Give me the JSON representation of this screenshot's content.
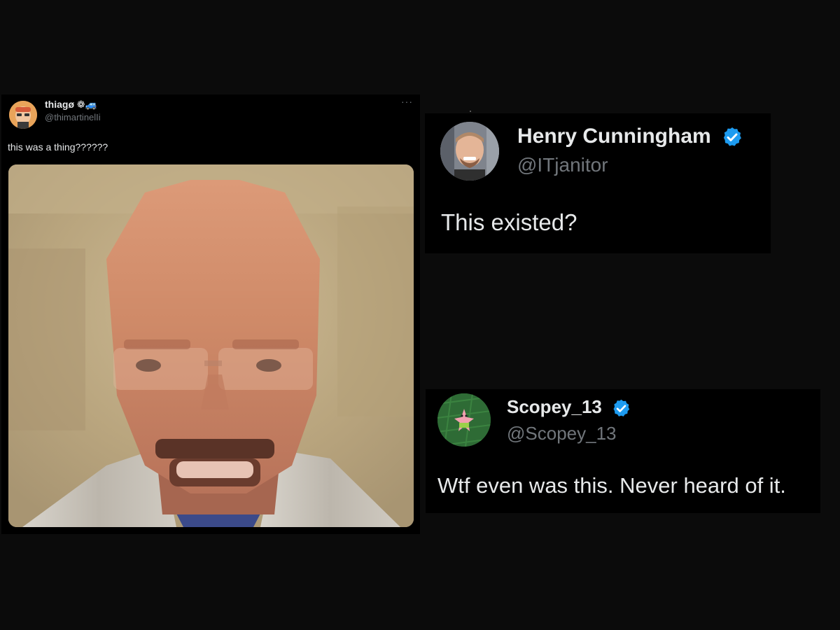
{
  "main_tweet": {
    "display_name": "thiagø ❁🚙",
    "handle": "@thimartinelIi",
    "more_label": "···",
    "text": "this was a thing??????",
    "media_icon": "low-poly-game-character-face-image"
  },
  "replies": [
    {
      "display_name": "Henry Cunningham",
      "handle": "@ITjanitor",
      "text": "This existed?",
      "verified": true,
      "avatar_icon": "smiling-man-photo-avatar"
    },
    {
      "display_name": "Scopey_13",
      "handle": "@Scopey_13",
      "text": "Wtf even was this. Never heard of it.",
      "verified": true,
      "avatar_icon": "cartoon-starfish-on-grass-avatar"
    }
  ],
  "colors": {
    "background": "#0b0b0b",
    "card": "#000000",
    "primary_text": "#e7e9ea",
    "secondary_text": "#71767b",
    "verified_blue": "#1d9bf0"
  }
}
